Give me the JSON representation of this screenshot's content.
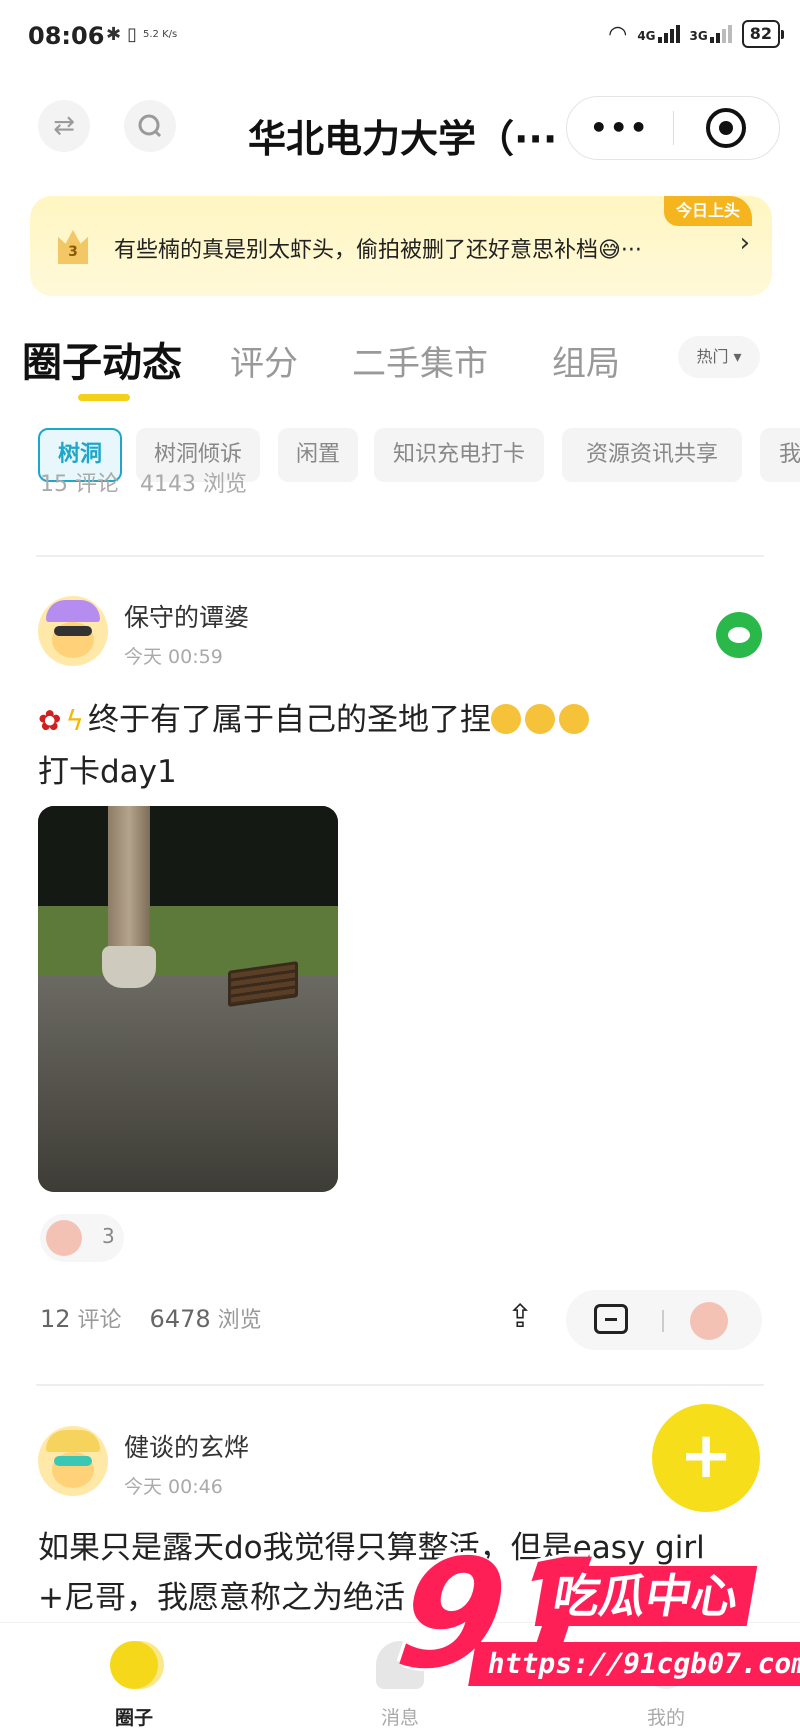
{
  "status_bar": {
    "time": "08:06",
    "net_speed": "5.2 K/s",
    "sig1": "4G",
    "sig2": "3G",
    "battery": "82"
  },
  "nav": {
    "title": "华北电力大学（···",
    "swap_icon": "swap-icon",
    "search_icon": "search-icon",
    "more_label": "•••"
  },
  "banner": {
    "rank": "3",
    "text": "有些楠的真是别太虾头，偷拍被删了还好意思补档😅···",
    "tag": "今日上头",
    "arrow": "›"
  },
  "tabs": {
    "items": [
      "圈子动态",
      "评分",
      "二手集市",
      "组局"
    ],
    "active": 0,
    "sort_label": "热门 ▾"
  },
  "chips": {
    "items": [
      "树洞",
      "树洞倾诉",
      "闲置",
      "知识充电打卡",
      "资源资讯共享",
      "我"
    ],
    "active": 0
  },
  "prev_post": {
    "comments": "15 评论",
    "views": "4143 浏览"
  },
  "post1": {
    "username": "保守的谭婆",
    "time": "今天 00:59",
    "text_line1": "终于有了属于自己的圣地了捏",
    "text_line2": "打卡day1",
    "like_count": "3",
    "comments_num": "12",
    "comments_label": "评论",
    "views_num": "6478",
    "views_label": "浏览"
  },
  "post2": {
    "username": "健谈的玄烨",
    "time": "今天 00:46",
    "text_line1": "如果只是露天do我觉得只算整活，但是easy girl",
    "text_line2": "+尼哥，我愿意称之为绝活"
  },
  "fab": {
    "label": "+"
  },
  "bottom_nav": {
    "items": [
      "圈子",
      "消息",
      "我的"
    ],
    "active": 0
  },
  "watermark": {
    "number": "91",
    "title": "吃瓜中心",
    "url": "https://91cgb07.com"
  },
  "colors": {
    "accent_yellow": "#f5d01a",
    "chip_active": "#1ea7c9",
    "watermark_red": "#fe1f57",
    "wechat_green": "#2ab84a"
  }
}
